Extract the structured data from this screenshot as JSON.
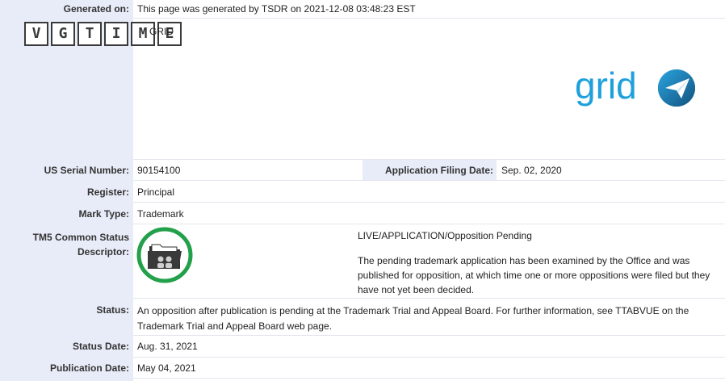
{
  "header": {
    "generated_label": "Generated on:",
    "generated_value": "This page was generated by TSDR on 2021-12-08 03:48:23 EST"
  },
  "watermark": {
    "letters": [
      "V",
      "G",
      "T",
      "I",
      "M",
      "E"
    ]
  },
  "mark": {
    "label_fragment": "GRID",
    "logo_text": "grid",
    "logo_color": "#1ea0dc"
  },
  "fields": {
    "serial_label": "US Serial Number:",
    "serial_value": "90154100",
    "filing_label": "Application Filing Date:",
    "filing_value": "Sep. 02, 2020",
    "register_label": "Register:",
    "register_value": "Principal",
    "marktype_label": "Mark Type:",
    "marktype_value": "Trademark",
    "tm5_label_line1": "TM5 Common Status",
    "tm5_label_line2": "Descriptor:",
    "tm5_status": "LIVE/APPLICATION/Opposition Pending",
    "tm5_description": "The pending trademark application has been examined by the Office and was published for opposition, at which time one or more oppositions were filed but they have not yet been decided.",
    "status_label": "Status:",
    "status_value": "An opposition after publication is pending at the Trademark Trial and Appeal Board. For further information, see TTABVUE on the Trademark Trial and Appeal Board web page.",
    "status_date_label": "Status Date:",
    "status_date_value": "Aug. 31, 2021",
    "pub_date_label": "Publication Date:",
    "pub_date_value": "May 04, 2021"
  },
  "colors": {
    "label_column_bg": "#e8ecf8",
    "status_ring": "#22a04a"
  }
}
